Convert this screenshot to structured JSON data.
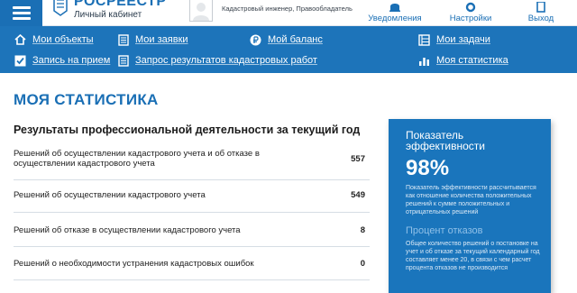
{
  "header": {
    "logo_title": "РОСРЕЕСТР",
    "logo_subtitle": "Личный кабинет",
    "user_role": "Кадастровый инженер, Правообладатель",
    "notifications_label": "Уведомления",
    "settings_label": "Настройки",
    "logout_label": "Выход",
    "accent": "#1a6fb5"
  },
  "nav": {
    "my_objects": "Мои объекты",
    "my_requests": "Мои заявки",
    "my_balance": "Мой баланс",
    "my_tasks": "Мои задачи",
    "appointment": "Запись на прием",
    "cadastral_results": "Запрос результатов кадастровых работ",
    "my_statistics": "Моя статистика",
    "bg_color": "#1d74ba"
  },
  "main": {
    "page_title": "МОЯ СТАТИСТИКА",
    "section_title": "Результаты профессиональной деятельности за текущий год",
    "stats": [
      {
        "label": "Решений об осуществлении кадастрового учета и об отказе в осуществлении кадастрового учета",
        "value": "557"
      },
      {
        "label": "Решений об осуществлении кадастрового учета",
        "value": "549"
      },
      {
        "label": "Решений об отказе в осуществлении кадастрового учета",
        "value": "8"
      },
      {
        "label": "Решений о необходимости устранения кадастровых ошибок",
        "value": "0"
      }
    ]
  },
  "panel": {
    "title": "Показатель эффективности",
    "value": "98%",
    "description": "Показатель эффективности рассчитывается как отношение количества положительных решений к сумме положительных и отрицательных решений",
    "subtitle": "Процент отказов",
    "subdescription": "Общее количество решений о постановке на учет и об отказе за текущий календарный год составляет менее 20, в связи с чем расчет процента отказов не производится",
    "bg_color": "#1a75bc"
  }
}
